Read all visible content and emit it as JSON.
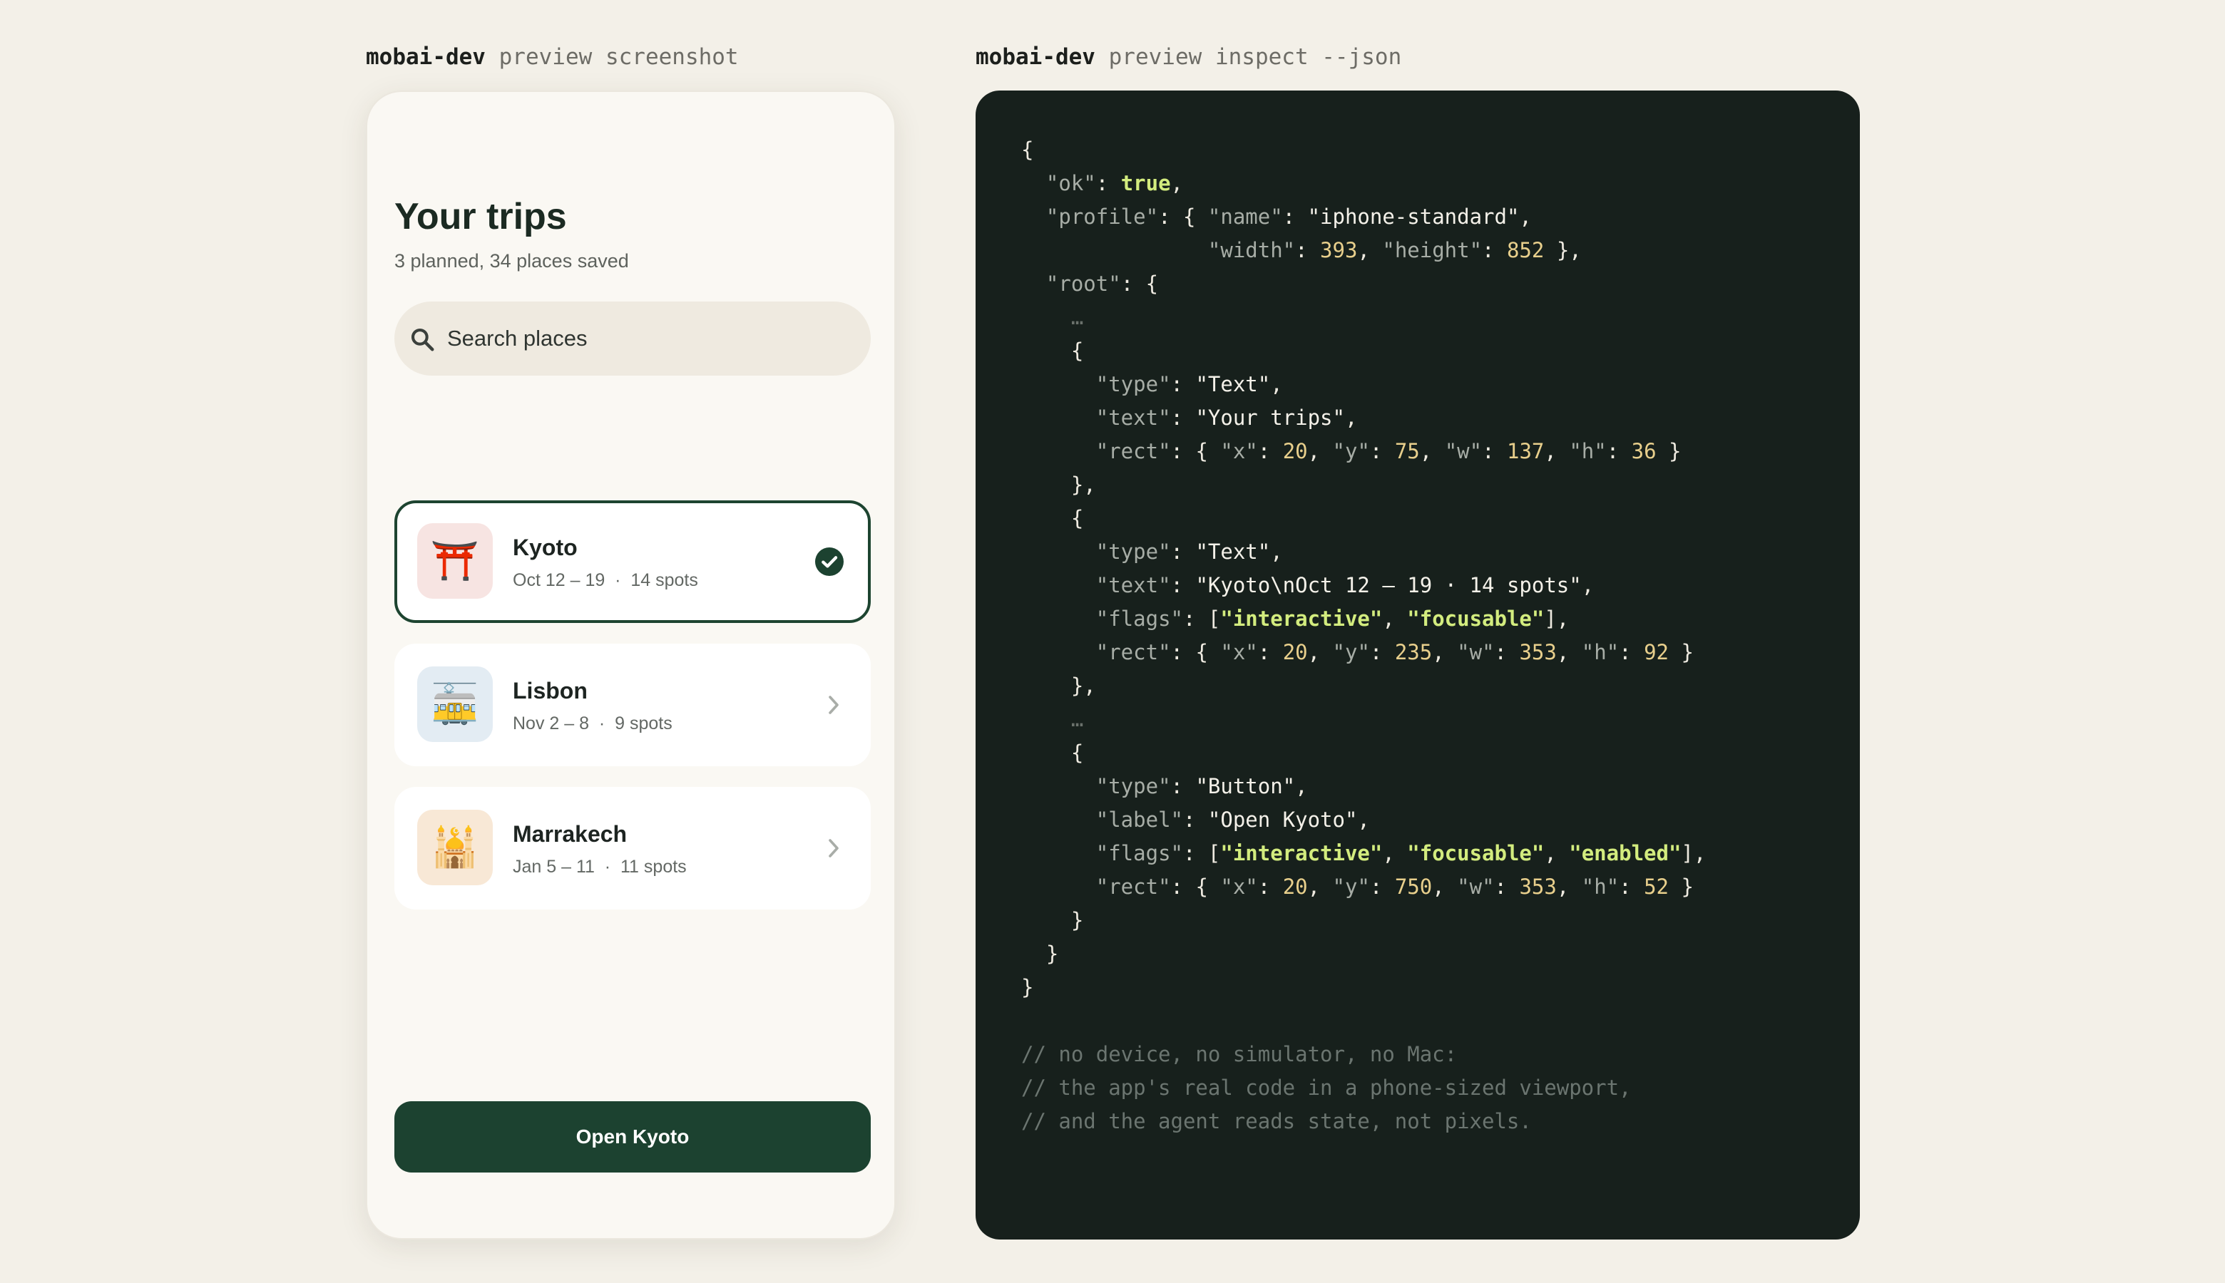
{
  "captions": {
    "left": {
      "cmd": "mobai-dev",
      "rest": " preview screenshot"
    },
    "right": {
      "cmd": "mobai-dev",
      "rest": " preview inspect --json"
    }
  },
  "app": {
    "title": "Your trips",
    "subtitle": "3 planned, 34 places saved",
    "search": {
      "placeholder": "Search places",
      "value": ""
    },
    "trips": [
      {
        "name": "Kyoto",
        "meta": "Oct 12 – 19  ·  14 spots",
        "icon": "⛩️",
        "icon_name": "torii-gate-icon",
        "thumb_bg": "#f7e4e2",
        "selected": true
      },
      {
        "name": "Lisbon",
        "meta": "Nov 2 – 8  ·  9 spots",
        "icon": "🚋",
        "icon_name": "tram-icon",
        "thumb_bg": "#e3ecf3",
        "selected": false
      },
      {
        "name": "Marrakech",
        "meta": "Jan 5 – 11  ·  11 spots",
        "icon": "🕌",
        "icon_name": "mosque-icon",
        "thumb_bg": "#f8e8d6",
        "selected": false
      }
    ],
    "open_button": "Open Kyoto"
  },
  "colors": {
    "accent": "#1c4230",
    "background": "#f3f0e8",
    "panel": "#17201c"
  },
  "json_output": {
    "lines": [
      [
        [
          "p",
          "{"
        ]
      ],
      [
        [
          "p",
          "  "
        ],
        [
          "k",
          "\"ok\""
        ],
        [
          "p",
          ": "
        ],
        [
          "b",
          "true"
        ],
        [
          "p",
          ","
        ]
      ],
      [
        [
          "p",
          "  "
        ],
        [
          "k",
          "\"profile\""
        ],
        [
          "p",
          ": { "
        ],
        [
          "k",
          "\"name\""
        ],
        [
          "p",
          ": "
        ],
        [
          "s",
          "\"iphone-standard\""
        ],
        [
          "p",
          ","
        ]
      ],
      [
        [
          "p",
          "               "
        ],
        [
          "k",
          "\"width\""
        ],
        [
          "p",
          ": "
        ],
        [
          "n",
          "393"
        ],
        [
          "p",
          ", "
        ],
        [
          "k",
          "\"height\""
        ],
        [
          "p",
          ": "
        ],
        [
          "n",
          "852"
        ],
        [
          "p",
          " },"
        ]
      ],
      [
        [
          "p",
          "  "
        ],
        [
          "k",
          "\"root\""
        ],
        [
          "p",
          ": {"
        ]
      ],
      [
        [
          "e",
          "    …"
        ]
      ],
      [
        [
          "p",
          "    {"
        ]
      ],
      [
        [
          "p",
          "      "
        ],
        [
          "k",
          "\"type\""
        ],
        [
          "p",
          ": "
        ],
        [
          "s",
          "\"Text\""
        ],
        [
          "p",
          ","
        ]
      ],
      [
        [
          "p",
          "      "
        ],
        [
          "k",
          "\"text\""
        ],
        [
          "p",
          ": "
        ],
        [
          "s",
          "\"Your trips\""
        ],
        [
          "p",
          ","
        ]
      ],
      [
        [
          "p",
          "      "
        ],
        [
          "k",
          "\"rect\""
        ],
        [
          "p",
          ": { "
        ],
        [
          "k",
          "\"x\""
        ],
        [
          "p",
          ": "
        ],
        [
          "n",
          "20"
        ],
        [
          "p",
          ", "
        ],
        [
          "k",
          "\"y\""
        ],
        [
          "p",
          ": "
        ],
        [
          "n",
          "75"
        ],
        [
          "p",
          ", "
        ],
        [
          "k",
          "\"w\""
        ],
        [
          "p",
          ": "
        ],
        [
          "n",
          "137"
        ],
        [
          "p",
          ", "
        ],
        [
          "k",
          "\"h\""
        ],
        [
          "p",
          ": "
        ],
        [
          "n",
          "36"
        ],
        [
          "p",
          " }"
        ]
      ],
      [
        [
          "p",
          "    },"
        ]
      ],
      [
        [
          "p",
          "    {"
        ]
      ],
      [
        [
          "p",
          "      "
        ],
        [
          "k",
          "\"type\""
        ],
        [
          "p",
          ": "
        ],
        [
          "s",
          "\"Text\""
        ],
        [
          "p",
          ","
        ]
      ],
      [
        [
          "p",
          "      "
        ],
        [
          "k",
          "\"text\""
        ],
        [
          "p",
          ": "
        ],
        [
          "s",
          "\"Kyoto\\nOct 12 – 19 · 14 spots\""
        ],
        [
          "p",
          ","
        ]
      ],
      [
        [
          "p",
          "      "
        ],
        [
          "k",
          "\"flags\""
        ],
        [
          "p",
          ": ["
        ],
        [
          "bs",
          "\"interactive\""
        ],
        [
          "p",
          ", "
        ],
        [
          "bs",
          "\"focusable\""
        ],
        [
          "p",
          "],"
        ]
      ],
      [
        [
          "p",
          "      "
        ],
        [
          "k",
          "\"rect\""
        ],
        [
          "p",
          ": { "
        ],
        [
          "k",
          "\"x\""
        ],
        [
          "p",
          ": "
        ],
        [
          "n",
          "20"
        ],
        [
          "p",
          ", "
        ],
        [
          "k",
          "\"y\""
        ],
        [
          "p",
          ": "
        ],
        [
          "n",
          "235"
        ],
        [
          "p",
          ", "
        ],
        [
          "k",
          "\"w\""
        ],
        [
          "p",
          ": "
        ],
        [
          "n",
          "353"
        ],
        [
          "p",
          ", "
        ],
        [
          "k",
          "\"h\""
        ],
        [
          "p",
          ": "
        ],
        [
          "n",
          "92"
        ],
        [
          "p",
          " }"
        ]
      ],
      [
        [
          "p",
          "    },"
        ]
      ],
      [
        [
          "e",
          "    …"
        ]
      ],
      [
        [
          "p",
          "    {"
        ]
      ],
      [
        [
          "p",
          "      "
        ],
        [
          "k",
          "\"type\""
        ],
        [
          "p",
          ": "
        ],
        [
          "s",
          "\"Button\""
        ],
        [
          "p",
          ","
        ]
      ],
      [
        [
          "p",
          "      "
        ],
        [
          "k",
          "\"label\""
        ],
        [
          "p",
          ": "
        ],
        [
          "s",
          "\"Open Kyoto\""
        ],
        [
          "p",
          ","
        ]
      ],
      [
        [
          "p",
          "      "
        ],
        [
          "k",
          "\"flags\""
        ],
        [
          "p",
          ": ["
        ],
        [
          "bs",
          "\"interactive\""
        ],
        [
          "p",
          ", "
        ],
        [
          "bs",
          "\"focusable\""
        ],
        [
          "p",
          ", "
        ],
        [
          "bs",
          "\"enabled\""
        ],
        [
          "p",
          "],"
        ]
      ],
      [
        [
          "p",
          "      "
        ],
        [
          "k",
          "\"rect\""
        ],
        [
          "p",
          ": { "
        ],
        [
          "k",
          "\"x\""
        ],
        [
          "p",
          ": "
        ],
        [
          "n",
          "20"
        ],
        [
          "p",
          ", "
        ],
        [
          "k",
          "\"y\""
        ],
        [
          "p",
          ": "
        ],
        [
          "n",
          "750"
        ],
        [
          "p",
          ", "
        ],
        [
          "k",
          "\"w\""
        ],
        [
          "p",
          ": "
        ],
        [
          "n",
          "353"
        ],
        [
          "p",
          ", "
        ],
        [
          "k",
          "\"h\""
        ],
        [
          "p",
          ": "
        ],
        [
          "n",
          "52"
        ],
        [
          "p",
          " }"
        ]
      ],
      [
        [
          "p",
          "    }"
        ]
      ],
      [
        [
          "p",
          "  }"
        ]
      ],
      [
        [
          "p",
          "}"
        ]
      ],
      [
        [
          "p",
          ""
        ]
      ],
      [
        [
          "c",
          "// no device, no simulator, no Mac:"
        ]
      ],
      [
        [
          "c",
          "// the app's real code in a phone-sized viewport,"
        ]
      ],
      [
        [
          "c",
          "// and the agent reads state, not pixels."
        ]
      ]
    ]
  }
}
